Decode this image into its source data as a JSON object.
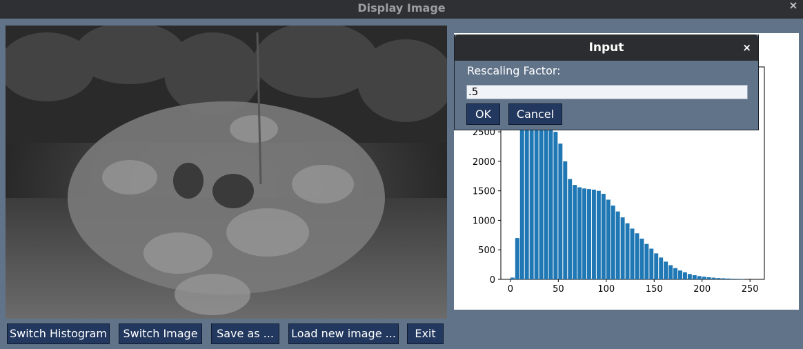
{
  "window": {
    "title": "Display Image",
    "close_glyph": "×"
  },
  "buttons": {
    "switch_histogram": "Switch Histogram",
    "switch_image": "Switch Image",
    "save_as": "Save as ...",
    "load_new_image": "Load new image ...",
    "exit": "Exit"
  },
  "dialog": {
    "title": "Input",
    "close_glyph": "×",
    "label": "Rescaling Factor:",
    "input_value": ".5",
    "ok_label": "OK",
    "cancel_label": "Cancel"
  },
  "chart_data": {
    "type": "bar",
    "color": "#1f77b4",
    "xlim": [
      -10,
      265
    ],
    "ylim": [
      0,
      3600
    ],
    "xticks": [
      0,
      50,
      100,
      150,
      200,
      250
    ],
    "yticks": [
      0,
      500,
      1000,
      1500,
      2000,
      2500
    ],
    "ytick_labels_visible": [
      "0",
      "500",
      "1000",
      "1500",
      "2000",
      "2500"
    ],
    "xtick_labels": [
      "0",
      "50",
      "100",
      "150",
      "200",
      "250"
    ],
    "x": [
      0,
      5,
      10,
      15,
      20,
      25,
      30,
      35,
      40,
      45,
      50,
      55,
      60,
      65,
      70,
      75,
      80,
      85,
      90,
      95,
      100,
      105,
      110,
      115,
      120,
      125,
      130,
      135,
      140,
      145,
      150,
      155,
      160,
      165,
      170,
      175,
      180,
      185,
      190,
      195,
      200,
      205,
      210,
      215,
      220,
      225,
      230,
      235,
      240,
      245
    ],
    "values": [
      30,
      700,
      3300,
      3000,
      2900,
      2850,
      2800,
      2750,
      2650,
      2500,
      2300,
      2000,
      1700,
      1600,
      1560,
      1540,
      1530,
      1520,
      1500,
      1450,
      1350,
      1250,
      1150,
      1050,
      950,
      860,
      780,
      690,
      600,
      520,
      440,
      370,
      300,
      240,
      190,
      150,
      120,
      90,
      70,
      55,
      45,
      35,
      28,
      22,
      18,
      14,
      10,
      8,
      6,
      0
    ]
  }
}
